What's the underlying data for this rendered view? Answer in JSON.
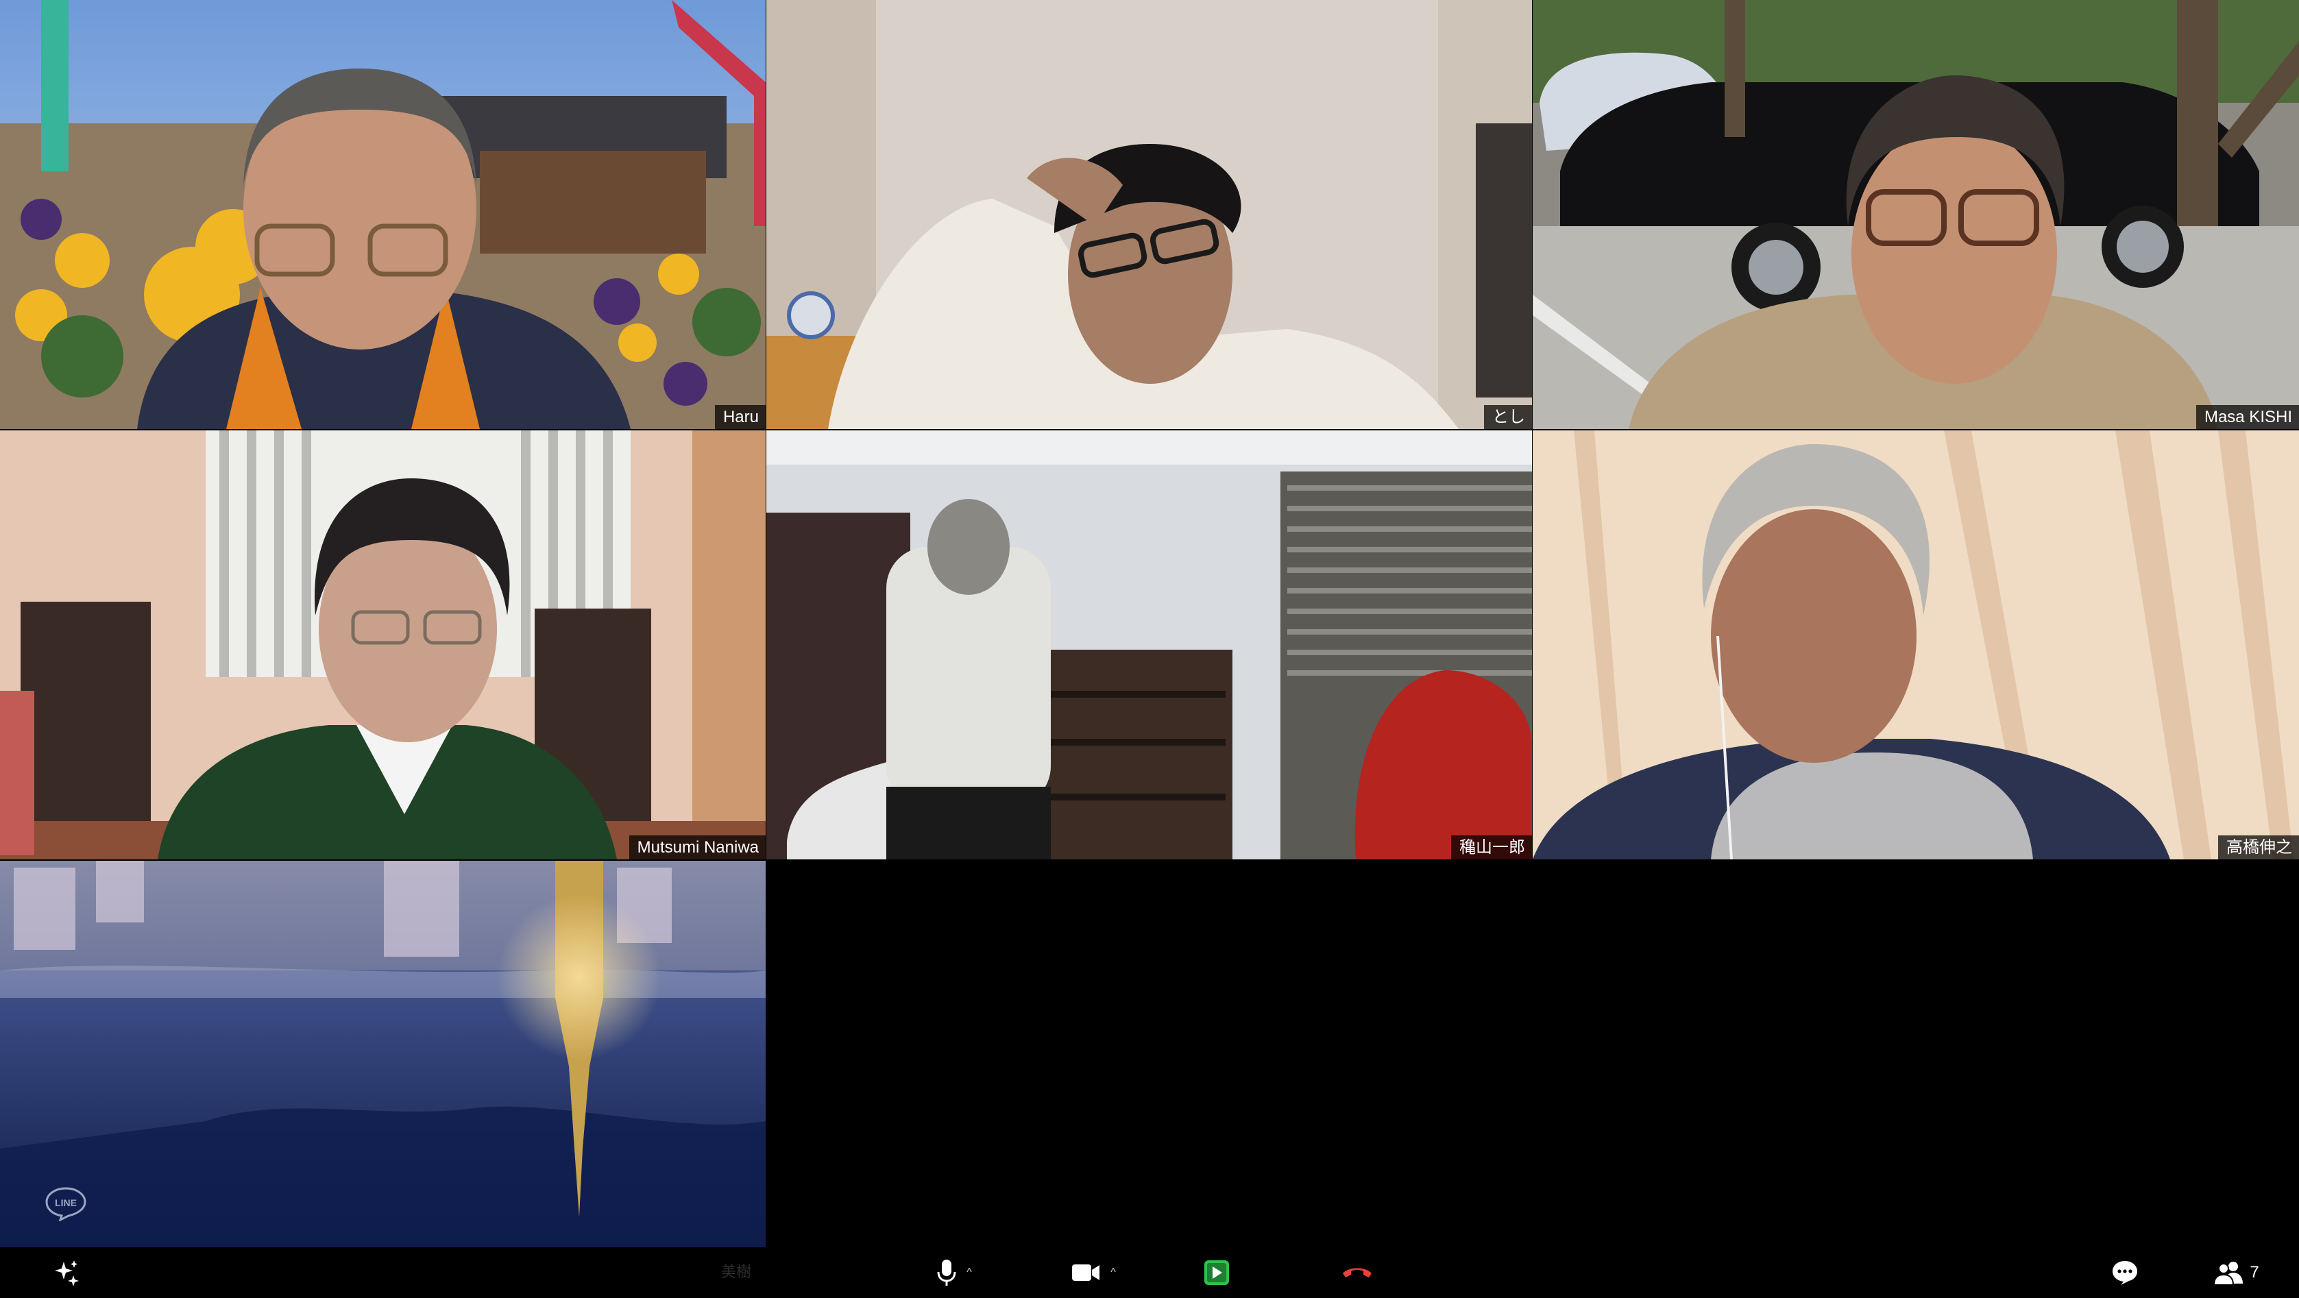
{
  "window": {
    "app": "video-meeting"
  },
  "participants": [
    {
      "name": "Haru",
      "video_on": true
    },
    {
      "name": "とし",
      "video_on": true
    },
    {
      "name": "Masa KISHI",
      "video_on": true
    },
    {
      "name": "Mutsumi Naniwa",
      "video_on": true
    },
    {
      "name": "穐山一郎",
      "video_on": true
    },
    {
      "name": "高橋伸之",
      "video_on": true
    },
    {
      "name": "",
      "video_on": true,
      "badge": "LINE"
    }
  ],
  "toolbar": {
    "self_name": "美樹",
    "participant_count": "7",
    "icons": {
      "effects": "sparkle-icon",
      "mic": "microphone-icon",
      "video": "video-camera-icon",
      "share": "share-screen-icon",
      "leave": "end-call-icon",
      "chat": "chat-icon",
      "participants": "participants-icon"
    },
    "colors": {
      "leave": "#e8423b",
      "share": "#2fc24c",
      "icon": "#ffffff"
    }
  }
}
